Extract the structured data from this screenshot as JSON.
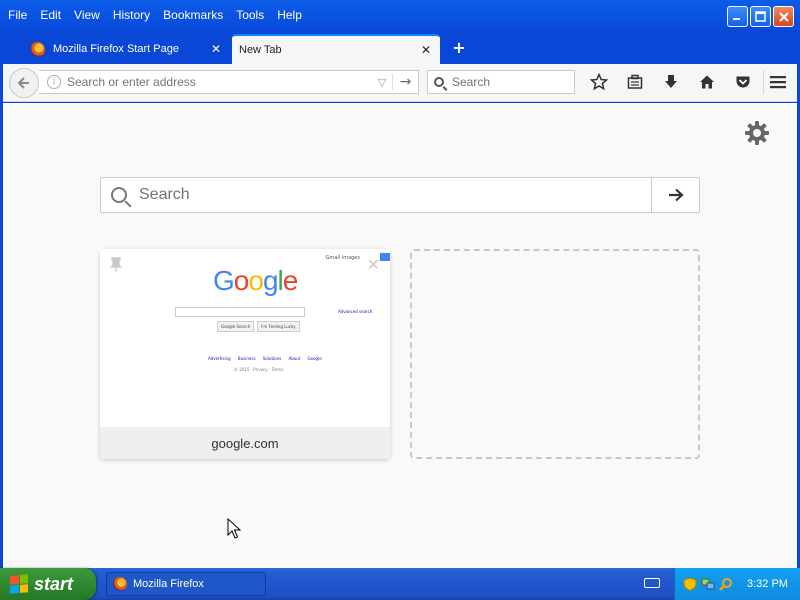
{
  "menubar": {
    "items": [
      {
        "label": "File"
      },
      {
        "label": "Edit"
      },
      {
        "label": "View"
      },
      {
        "label": "History"
      },
      {
        "label": "Bookmarks"
      },
      {
        "label": "Tools"
      },
      {
        "label": "Help"
      }
    ]
  },
  "tabs": [
    {
      "label": "Mozilla Firefox Start Page",
      "close": "✕"
    },
    {
      "label": "New Tab",
      "close": "✕"
    }
  ],
  "newtab_label": "+",
  "navbar": {
    "url_placeholder": "Search or enter address",
    "search_placeholder": "Search"
  },
  "content": {
    "search_placeholder": "Search",
    "tiles": [
      {
        "label": "google.com",
        "thumb": {
          "logo": [
            "G",
            "o",
            "o",
            "g",
            "l",
            "e"
          ],
          "top_links": "Gmail   Images",
          "advanced": "Advanced search",
          "btn1": "Google Search",
          "btn2": "I'm Feeling Lucky",
          "links": "Advertising Business Solutions About Google",
          "copy": "© 2015 · Privacy · Terms"
        }
      }
    ]
  },
  "taskbar": {
    "start_label": "start",
    "task_label": "Mozilla Firefox",
    "clock": "3:32 PM"
  },
  "colors": {
    "xp_blue": "#0a47d6",
    "accent": "#0a84ff",
    "start_green": "#2f8a2f"
  }
}
